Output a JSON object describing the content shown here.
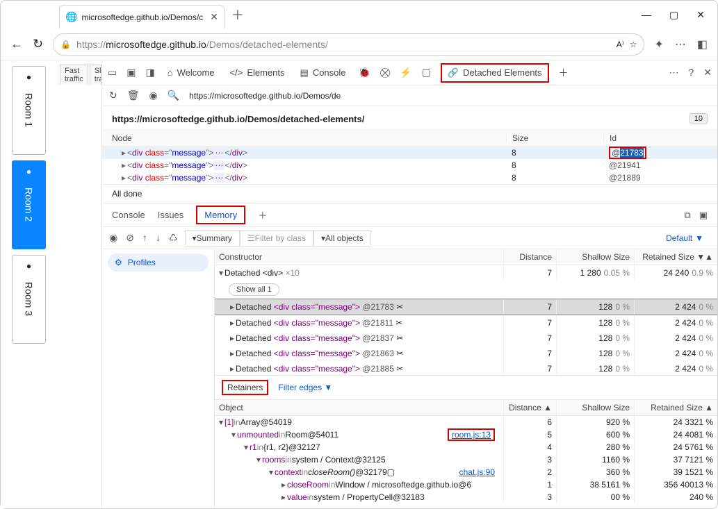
{
  "browser": {
    "tab_title": "microsoftedge.github.io/Demos/c",
    "url_gray": "https://",
    "url_dark": "microsoftedge.github.io",
    "url_tail": "/Demos/detached-elements/"
  },
  "app": {
    "rooms": [
      "Room 1",
      "Room 2",
      "Room 3"
    ],
    "active_room": 1,
    "traffic_tabs": [
      "Fast traffic",
      "Slow tra"
    ]
  },
  "devtools_tabs": {
    "welcome": "Welcome",
    "elements": "Elements",
    "console": "Console",
    "detached": "Detached Elements"
  },
  "toolbar_url": "https://microsoftedge.github.io/Demos/de",
  "detached": {
    "path": "https://microsoftedge.github.io/Demos/detached-elements/",
    "count_badge": "10",
    "headers": {
      "node": "Node",
      "size": "Size",
      "id": "Id"
    },
    "rows": [
      {
        "html": "<div class=\"message\">…</div>",
        "size": "8",
        "id": "@21783",
        "highlight_id": true
      },
      {
        "html": "<div class=\"message\">…</div>",
        "size": "8",
        "id": "@21941"
      },
      {
        "html": "<div class=\"message\">…</div>",
        "size": "8",
        "id": "@21889"
      }
    ],
    "status": "All done"
  },
  "drawer": {
    "tabs": {
      "console": "Console",
      "issues": "Issues",
      "memory": "Memory"
    }
  },
  "memory": {
    "profiles_label": "Profiles",
    "summary": "Summary",
    "filter_placeholder": "Filter by class",
    "all_objects": "All objects",
    "default_label": "Default",
    "headers": {
      "constructor": "Constructor",
      "distance": "Distance",
      "shallow": "Shallow Size",
      "retained": "Retained Size"
    },
    "group": {
      "label": "Detached <div>",
      "count": "×10",
      "distance": "7",
      "shallow": "1 280",
      "shallow_pct": "0.05 %",
      "retained": "24 240",
      "retained_pct": "0.9 %"
    },
    "show_all": "Show all 1",
    "items": [
      {
        "text": "Detached <div class=\"message\"> @21783",
        "distance": "7",
        "shallow": "128",
        "shallow_pct": "0 %",
        "retained": "2 424",
        "retained_pct": "0 %",
        "selected": true
      },
      {
        "text": "Detached <div class=\"message\"> @21811",
        "distance": "7",
        "shallow": "128",
        "shallow_pct": "0 %",
        "retained": "2 424",
        "retained_pct": "0 %"
      },
      {
        "text": "Detached <div class=\"message\"> @21837",
        "distance": "7",
        "shallow": "128",
        "shallow_pct": "0 %",
        "retained": "2 424",
        "retained_pct": "0 %"
      },
      {
        "text": "Detached <div class=\"message\"> @21863",
        "distance": "7",
        "shallow": "128",
        "shallow_pct": "0 %",
        "retained": "2 424",
        "retained_pct": "0 %"
      },
      {
        "text": "Detached <div class=\"message\"> @21885",
        "distance": "7",
        "shallow": "128",
        "shallow_pct": "0 %",
        "retained": "2 424",
        "retained_pct": "0 %"
      }
    ]
  },
  "retainers": {
    "label": "Retainers",
    "filter_edges": "Filter edges",
    "headers": {
      "object": "Object",
      "distance": "Distance",
      "shallow": "Shallow Size",
      "retained": "Retained Size"
    },
    "rows": [
      {
        "indent": 0,
        "open": true,
        "name": "[1]",
        "in": "in",
        "ctx": "Array",
        "id": "@54019",
        "src": "",
        "distance": "6",
        "shallow": "92",
        "shallow_pct": "0 %",
        "retained": "24 332",
        "retained_pct": "1 %"
      },
      {
        "indent": 1,
        "open": true,
        "name": "unmounted",
        "in": "in",
        "ctx": "Room",
        "id": "@54011",
        "src": "room.js:13",
        "src_hi": true,
        "distance": "5",
        "shallow": "60",
        "shallow_pct": "0 %",
        "retained": "24 408",
        "retained_pct": "1 %"
      },
      {
        "indent": 2,
        "open": true,
        "name": "r1",
        "in": "in",
        "ctx": "{r1, r2}",
        "id": "@32127",
        "src": "",
        "distance": "4",
        "shallow": "28",
        "shallow_pct": "0 %",
        "retained": "24 576",
        "retained_pct": "1 %"
      },
      {
        "indent": 3,
        "open": true,
        "name": "rooms",
        "in": "in",
        "ctx": "system / Context",
        "id": "@32125",
        "src": "",
        "distance": "3",
        "shallow": "116",
        "shallow_pct": "0 %",
        "retained": "37 712",
        "retained_pct": "1 %"
      },
      {
        "indent": 4,
        "open": true,
        "name": "context",
        "in": "in",
        "ctx": "closeRoom()",
        "ctx_italic": true,
        "id": "@32179",
        "src": "chat.js:90",
        "distance": "2",
        "shallow": "36",
        "shallow_pct": "0 %",
        "retained": "39 152",
        "retained_pct": "1 %"
      },
      {
        "indent": 5,
        "open": false,
        "name": "closeRoom",
        "in": "in",
        "ctx": "Window / microsoftedge.github.io",
        "id": "@6",
        "src": "",
        "distance": "1",
        "shallow": "38 516",
        "shallow_pct": "1 %",
        "retained": "356 400",
        "retained_pct": "13 %"
      },
      {
        "indent": 5,
        "open": false,
        "name": "value",
        "in": "in",
        "ctx": "system / PropertyCell",
        "id": "@32183",
        "src": "",
        "distance": "3",
        "shallow": "0",
        "shallow_pct": "0 %",
        "retained": "24",
        "retained_pct": "0 %"
      }
    ]
  }
}
